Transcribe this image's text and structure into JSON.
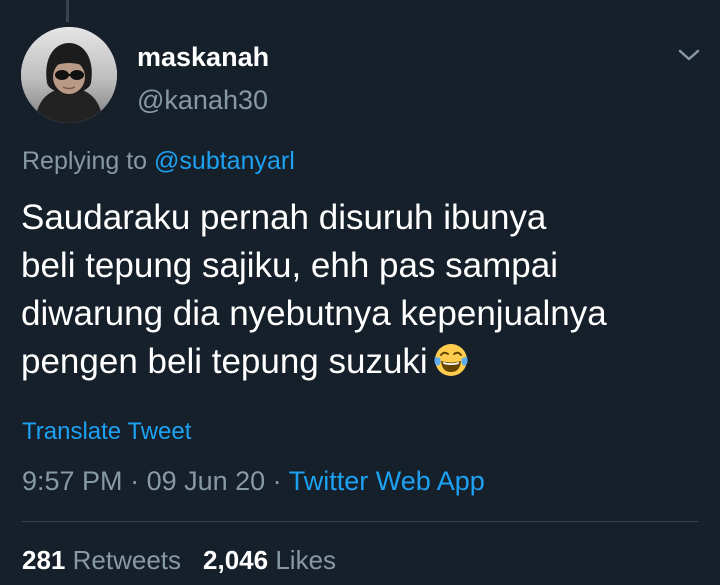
{
  "user": {
    "display_name": "maskanah",
    "handle": "@kanah30"
  },
  "reply": {
    "prefix": "Replying to ",
    "mention": "@subtanyarl"
  },
  "tweet": {
    "lines": [
      "Saudaraku pernah disuruh ibunya",
      "beli tepung sajiku, ehh pas sampai",
      "diwarung dia nyebutnya kepenjualnya",
      "pengen beli tepung suzuki"
    ],
    "emoji": "face-with-tears-of-joy-icon",
    "translate_label": "Translate Tweet"
  },
  "meta": {
    "time": "9:57 PM",
    "separator": " · ",
    "date": "09 Jun 20",
    "source": "Twitter Web App"
  },
  "stats": {
    "retweets_count": "281",
    "retweets_label": "Retweets",
    "likes_count": "2,046",
    "likes_label": "Likes"
  },
  "colors": {
    "background": "#15202b",
    "primary_text": "#ffffff",
    "secondary_text": "#8899a6",
    "accent": "#1da1f2",
    "divider": "#38444d"
  },
  "icons": {
    "menu": "chevron-down-icon"
  }
}
